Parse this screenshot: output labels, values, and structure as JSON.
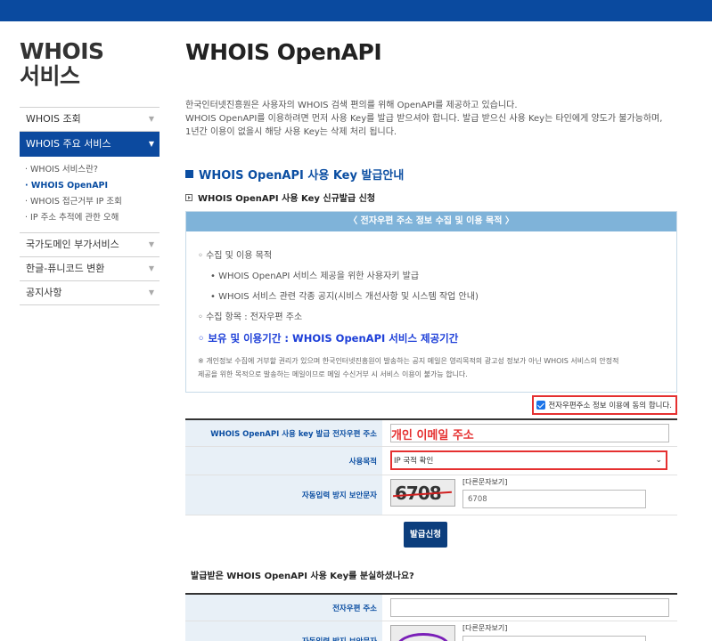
{
  "sidebar": {
    "title_line1": "WHOIS",
    "title_line2": "서비스",
    "menu": [
      {
        "label": "WHOIS 조회"
      },
      {
        "label": "WHOIS 주요 서비스"
      },
      {
        "label": "국가도메인 부가서비스"
      },
      {
        "label": "한글-퓨니코드 변환"
      },
      {
        "label": "공지사항"
      }
    ],
    "submenu": [
      "· WHOIS 서비스란?",
      "· WHOIS OpenAPI",
      "· WHOIS 접근거부 IP 조회",
      "· IP 주소 추적에 관한 오해"
    ]
  },
  "main": {
    "title": "WHOIS OpenAPI",
    "intro": [
      "한국인터넷진흥원은 사용자의 WHOIS 검색 편의를 위해 OpenAPI를 제공하고 있습니다.",
      "WHOIS OpenAPI를 이용하려면 먼저 사용 Key를 발급 받으셔야 합니다. 발급 받으신 사용 Key는 타인에게 양도가 불가능하며,",
      "1년간 이용이 없을시 해당 사용 Key는 삭제 처리 됩니다."
    ],
    "section_title": "WHOIS OpenAPI 사용 Key 발급안내",
    "sub_title": "WHOIS OpenAPI 사용 Key 신규발급 신청",
    "notice": {
      "header": "〈 전자우편 주소 정보 수집 및 이용 목적 〉",
      "purpose_label": "◦ 수집 및 이용 목적",
      "purpose_items": [
        "•  WHOIS OpenAPI 서비스 제공을 위한 사용자키 발급",
        "•  WHOIS 서비스 관련 각종 공지(시비스 개선사항 및 시스템 작업 안내)"
      ],
      "items_label": "◦ 수집 항목 : 전자우편 주소",
      "retention": "◦ 보유 및 이용기간 : WHOIS OpenAPI 서비스 제공기간",
      "footnote_1": "※ 개인정보 수집에 거부할 권리가 있으며 한국인터넷진흥원이 발송하는 공지 메일은 영리목적의 광고성 정보가 아닌 WHOIS 서비스의 안정적",
      "footnote_2": "제공을 위한 목적으로 발송하는 메일이므로 메일 수신거부 시 서비스 이용이 불가능 합니다."
    },
    "agree_label": "전자우편주소 정보 이용에 동의 합니다.",
    "form": {
      "email_label": "WHOIS OpenAPI 사용 key 발급 전자우편 주소",
      "email_placeholder": "개인 이메일 주소",
      "purpose_label": "사용목적",
      "purpose_value": "IP 국적 확인",
      "captcha_label": "자동입력 방지 보안문자",
      "captcha_image_text": "6708",
      "captcha_refresh": "[다른문자보기]",
      "captcha_value": "6708",
      "submit": "발급신청"
    },
    "lost_title": "발급받은 WHOIS OpenAPI 사용 Key를 분실하셨나요?",
    "form2": {
      "email_label": "전자우편 주소",
      "captcha_label": "자동입력 방지 보안문자",
      "captcha_refresh": "[다른문자보기]"
    }
  },
  "colors": {
    "brand_blue": "#0b4ea2",
    "highlight_red": "#e53030",
    "notice_header": "#7fb3d9"
  }
}
